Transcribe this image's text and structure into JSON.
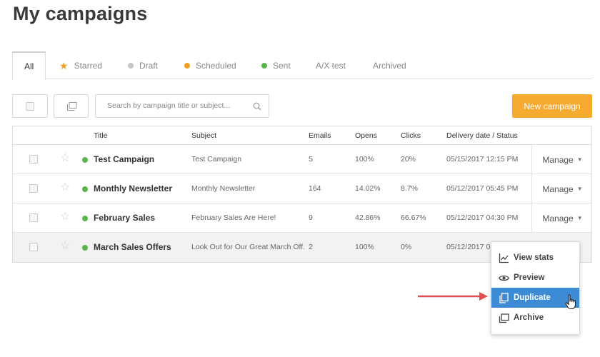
{
  "page": {
    "title": "My campaigns"
  },
  "tabs": [
    {
      "label": "All",
      "active": true
    },
    {
      "label": "Starred",
      "icon": "star-icon",
      "color": "#f0a21f"
    },
    {
      "label": "Draft",
      "color": "#c4c4c4"
    },
    {
      "label": "Scheduled",
      "color": "#f0a21f"
    },
    {
      "label": "Sent",
      "color": "#5ab54a"
    },
    {
      "label": "A/X test"
    },
    {
      "label": "Archived"
    }
  ],
  "toolbar": {
    "search_placeholder": "Search by campaign title or subject...",
    "new_campaign_label": "New campaign"
  },
  "table": {
    "headers": {
      "title": "Title",
      "subject": "Subject",
      "emails": "Emails",
      "opens": "Opens",
      "clicks": "Clicks",
      "delivery": "Delivery date / Status"
    },
    "rows": [
      {
        "title": "Test Campaign",
        "subject": "Test Campaign",
        "emails": "5",
        "opens": "100%",
        "clicks": "20%",
        "date": "05/15/2017 12:15 PM",
        "manage": "Manage"
      },
      {
        "title": "Monthly Newsletter",
        "subject": "Monthly Newsletter",
        "emails": "164",
        "opens": "14.02%",
        "clicks": "8.7%",
        "date": "05/12/2017 05:45 PM",
        "manage": "Manage"
      },
      {
        "title": "February Sales",
        "subject": "February Sales Are Here!",
        "emails": "9",
        "opens": "42.86%",
        "clicks": "66.67%",
        "date": "05/12/2017 04:30 PM",
        "manage": "Manage"
      },
      {
        "title": "March Sales Offers",
        "subject": "Look Out for Our Great March Off...",
        "emails": "2",
        "opens": "100%",
        "clicks": "0%",
        "date": "05/12/2017 0"
      }
    ]
  },
  "menu": {
    "items": [
      {
        "label": "View stats",
        "icon": "chart-icon"
      },
      {
        "label": "Preview",
        "icon": "eye-icon"
      },
      {
        "label": "Duplicate",
        "icon": "duplicate-icon",
        "active": true
      },
      {
        "label": "Archive",
        "icon": "archive-icon"
      }
    ]
  },
  "colors": {
    "accent": "#f6ab30",
    "sent_green": "#5ab54a",
    "menu_highlight": "#3d8bd4",
    "annotation_arrow": "#e05050"
  }
}
